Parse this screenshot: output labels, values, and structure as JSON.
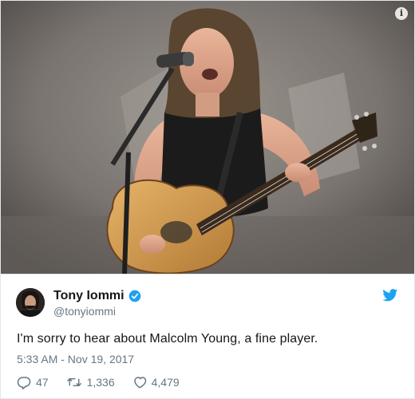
{
  "tweet": {
    "author_name": "Tony Iommi",
    "handle": "@tonyiommi",
    "text": "I'm sorry to hear about Malcolm Young, a fine player.",
    "timestamp": "5:33 AM - Nov 19, 2017",
    "replies": "47",
    "retweets": "1,336",
    "likes": "4,479"
  },
  "photo": {
    "info_glyph": "i"
  },
  "colors": {
    "twitter_blue": "#1da1f2",
    "text_primary": "#14171a",
    "text_secondary": "#657786"
  },
  "icons": [
    "info-icon",
    "verified-badge-icon",
    "twitter-bird-icon",
    "reply-icon",
    "retweet-icon",
    "like-icon"
  ]
}
